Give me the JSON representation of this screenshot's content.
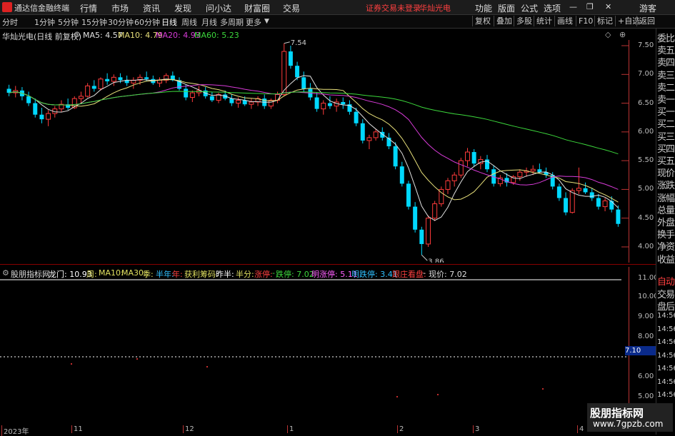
{
  "titlebar": {
    "app_name": "通达信金融终端",
    "menus": [
      "行情",
      "市场",
      "资讯",
      "发现",
      "问小达",
      "财富圈",
      "交易"
    ],
    "notice": "证券交易未登录",
    "stock_name": "华灿光电",
    "right_menus": [
      "功能",
      "版面",
      "公式",
      "选项"
    ],
    "user": "游客"
  },
  "toolbar": {
    "tabs": [
      "分时",
      "1分钟",
      "5分钟",
      "15分钟",
      "30分钟",
      "60分钟",
      "日线",
      "周线",
      "月线",
      "多周期",
      "更多"
    ],
    "active_tab": "日线",
    "right_buttons": [
      "复权",
      "叠加",
      "多股",
      "统计",
      "画线",
      "F10",
      "标记",
      "+自选",
      "返回"
    ]
  },
  "info": {
    "stock_title": "华灿光电(日线 前复权)",
    "ma5": "MA5: 4.57",
    "ma10": "MA10: 4.79",
    "ma20": "MA20: 4.93",
    "ma60": "MA60: 5.23"
  },
  "right_labels": [
    "委比",
    "卖五",
    "卖四",
    "卖三",
    "卖二",
    "卖一",
    "买一",
    "买二",
    "买三",
    "买四",
    "买五",
    "现价",
    "涨跌",
    "涨幅",
    "总量",
    "外盘",
    "换手",
    "净资",
    "收益",
    "自动",
    "交易",
    "盘后",
    "14:56",
    "14:56",
    "14:56",
    "14:56",
    "14:56",
    "14:56",
    "14:56"
  ],
  "indicator": {
    "name": "股朋指标网",
    "longmen": "龙门: 10.93",
    "zhou": "周:",
    "ma10": "MA10:",
    "ma30": "MA30:",
    "ji": "季:",
    "bannian": "半年:",
    "nian": "年:",
    "huoli": "获利筹码:",
    "zuoban": "昨半:",
    "banfen": "半分:",
    "zhangting": "涨停:",
    "dieting": "跌停: 7.02",
    "mingzhangting": "明涨停: 5.11",
    "mingdieting": "明跌停: 3.41",
    "genzhuang": "跟庄看盘:",
    "xianjia": "现价: 7.02",
    "value_box": "7.10",
    "dash": "-"
  },
  "watermark": {
    "line1": "股朋指标网",
    "line2": "www.7gpzb.com"
  },
  "chart_data": [
    {
      "type": "candlestick",
      "title": "华灿光电(日线 前复权)",
      "yticks": [
        4.0,
        4.5,
        5.0,
        5.5,
        6.0,
        6.5,
        7.0,
        7.5
      ],
      "ylim": [
        3.75,
        7.75
      ],
      "x_labels": [
        "2023年",
        "11",
        "12",
        "1",
        "2",
        "3",
        "4"
      ],
      "annotations": [
        {
          "text": "7.54",
          "value": 7.54
        },
        {
          "text": "3.86",
          "value": 3.86
        }
      ],
      "colors": {
        "up": "#ff3b3b",
        "down": "#00d8ff",
        "ma5": "#e0e0e0",
        "ma10": "#e8e07a",
        "ma20": "#d83bd8",
        "ma60": "#3cd83c"
      },
      "candles": [
        [
          6.75,
          6.82,
          6.62,
          6.68
        ],
        [
          6.68,
          6.8,
          6.6,
          6.72
        ],
        [
          6.72,
          6.78,
          6.55,
          6.62
        ],
        [
          6.62,
          6.7,
          6.45,
          6.5
        ],
        [
          6.5,
          6.58,
          6.25,
          6.3
        ],
        [
          6.3,
          6.42,
          6.15,
          6.22
        ],
        [
          6.22,
          6.38,
          6.1,
          6.32
        ],
        [
          6.32,
          6.45,
          6.25,
          6.4
        ],
        [
          6.4,
          6.55,
          6.35,
          6.48
        ],
        [
          6.48,
          6.58,
          6.38,
          6.42
        ],
        [
          6.42,
          6.62,
          6.4,
          6.58
        ],
        [
          6.58,
          6.7,
          6.5,
          6.62
        ],
        [
          6.62,
          6.85,
          6.6,
          6.8
        ],
        [
          6.8,
          6.9,
          6.7,
          6.75
        ],
        [
          6.75,
          6.95,
          6.72,
          6.92
        ],
        [
          6.92,
          7.02,
          6.82,
          6.88
        ],
        [
          6.88,
          7.0,
          6.8,
          6.95
        ],
        [
          6.95,
          7.02,
          6.85,
          6.9
        ],
        [
          6.9,
          6.98,
          6.8,
          6.85
        ],
        [
          6.85,
          6.95,
          6.75,
          6.9
        ],
        [
          6.9,
          7.0,
          6.82,
          6.95
        ],
        [
          6.95,
          7.05,
          6.88,
          6.92
        ],
        [
          6.92,
          6.98,
          6.82,
          6.85
        ],
        [
          6.85,
          6.95,
          6.78,
          6.9
        ],
        [
          6.9,
          7.02,
          6.85,
          6.98
        ],
        [
          6.98,
          7.05,
          6.88,
          6.9
        ],
        [
          6.9,
          6.95,
          6.72,
          6.75
        ],
        [
          6.75,
          6.82,
          6.55,
          6.6
        ],
        [
          6.6,
          6.72,
          6.52,
          6.68
        ],
        [
          6.68,
          6.8,
          6.62,
          6.72
        ],
        [
          6.72,
          6.78,
          6.58,
          6.62
        ],
        [
          6.62,
          6.7,
          6.52,
          6.55
        ],
        [
          6.55,
          6.68,
          6.5,
          6.65
        ],
        [
          6.65,
          6.72,
          6.55,
          6.58
        ],
        [
          6.58,
          6.65,
          6.45,
          6.5
        ],
        [
          6.5,
          6.6,
          6.42,
          6.55
        ],
        [
          6.55,
          6.62,
          6.45,
          6.48
        ],
        [
          6.48,
          6.58,
          6.4,
          6.52
        ],
        [
          6.52,
          6.62,
          6.45,
          6.58
        ],
        [
          6.58,
          6.65,
          6.4,
          6.45
        ],
        [
          6.45,
          6.58,
          6.4,
          6.55
        ],
        [
          6.55,
          6.7,
          6.5,
          6.65
        ],
        [
          6.65,
          7.54,
          6.62,
          7.4
        ],
        [
          7.4,
          7.5,
          7.1,
          7.15
        ],
        [
          7.15,
          7.22,
          6.9,
          6.95
        ],
        [
          6.95,
          7.05,
          6.7,
          6.75
        ],
        [
          6.75,
          6.85,
          6.55,
          6.6
        ],
        [
          6.6,
          6.68,
          6.35,
          6.4
        ],
        [
          6.4,
          6.55,
          6.3,
          6.5
        ],
        [
          6.5,
          6.62,
          6.4,
          6.45
        ],
        [
          6.45,
          6.58,
          6.35,
          6.52
        ],
        [
          6.52,
          6.6,
          6.4,
          6.48
        ],
        [
          6.48,
          6.55,
          6.3,
          6.35
        ],
        [
          6.35,
          6.42,
          6.1,
          6.15
        ],
        [
          6.15,
          6.22,
          5.8,
          5.85
        ],
        [
          5.85,
          5.95,
          5.7,
          5.9
        ],
        [
          5.9,
          6.05,
          5.85,
          6.0
        ],
        [
          6.0,
          6.08,
          5.85,
          5.9
        ],
        [
          5.9,
          5.98,
          5.7,
          5.75
        ],
        [
          5.75,
          5.82,
          5.35,
          5.4
        ],
        [
          5.4,
          5.48,
          5.05,
          5.1
        ],
        [
          5.1,
          5.15,
          4.65,
          4.7
        ],
        [
          4.7,
          4.78,
          4.25,
          4.3
        ],
        [
          4.3,
          4.35,
          3.86,
          4.05
        ],
        [
          4.05,
          4.55,
          4.0,
          4.5
        ],
        [
          4.5,
          4.8,
          4.45,
          4.75
        ],
        [
          4.75,
          5.05,
          4.7,
          5.0
        ],
        [
          5.0,
          5.2,
          4.92,
          5.15
        ],
        [
          5.15,
          5.3,
          5.05,
          5.25
        ],
        [
          5.25,
          5.55,
          5.2,
          5.5
        ],
        [
          5.5,
          5.72,
          5.4,
          5.65
        ],
        [
          5.65,
          5.7,
          5.4,
          5.45
        ],
        [
          5.45,
          5.58,
          5.35,
          5.52
        ],
        [
          5.52,
          5.6,
          5.3,
          5.35
        ],
        [
          5.35,
          5.42,
          5.05,
          5.1
        ],
        [
          5.1,
          5.25,
          5.05,
          5.2
        ],
        [
          5.2,
          5.28,
          5.05,
          5.12
        ],
        [
          5.12,
          5.25,
          5.08,
          5.22
        ],
        [
          5.22,
          5.35,
          5.15,
          5.3
        ],
        [
          5.3,
          5.38,
          5.22,
          5.32
        ],
        [
          5.32,
          5.42,
          5.25,
          5.35
        ],
        [
          5.35,
          5.45,
          5.28,
          5.3
        ],
        [
          5.3,
          5.38,
          5.2,
          5.25
        ],
        [
          5.25,
          5.3,
          5.0,
          5.05
        ],
        [
          5.05,
          5.1,
          4.8,
          4.85
        ],
        [
          4.85,
          4.95,
          4.55,
          4.6
        ],
        [
          4.6,
          5.02,
          4.58,
          4.98
        ],
        [
          4.98,
          5.38,
          4.92,
          5.02
        ],
        [
          5.02,
          5.12,
          4.92,
          4.95
        ],
        [
          4.95,
          5.02,
          4.8,
          4.85
        ],
        [
          4.85,
          4.92,
          4.65,
          4.7
        ],
        [
          4.7,
          4.85,
          4.62,
          4.8
        ],
        [
          4.8,
          4.88,
          4.6,
          4.65
        ],
        [
          4.65,
          4.72,
          4.35,
          4.4
        ]
      ]
    }
  ]
}
